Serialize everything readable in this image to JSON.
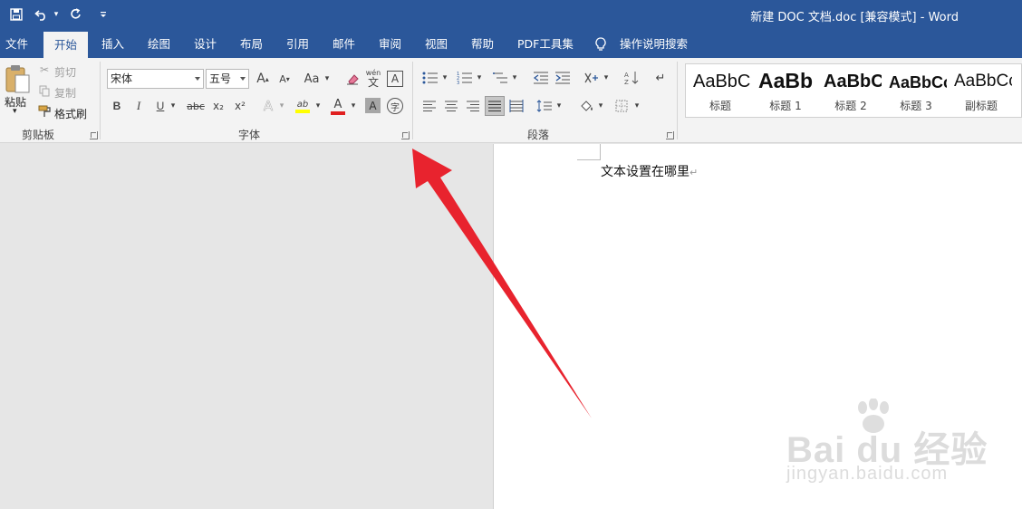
{
  "titlebar": {
    "title": "新建 DOC 文档.doc [兼容模式]  -  Word",
    "quick_access": [
      "save-icon",
      "undo-icon",
      "redo-icon",
      "customize-icon"
    ]
  },
  "tabs": [
    "文件",
    "开始",
    "插入",
    "绘图",
    "设计",
    "布局",
    "引用",
    "邮件",
    "审阅",
    "视图",
    "帮助",
    "PDF工具集",
    "操作说明搜索"
  ],
  "active_tab": "开始",
  "clipboard": {
    "paste_label": "粘贴",
    "cut_label": "剪切",
    "copy_label": "复制",
    "format_painter_label": "格式刷",
    "group_label": "剪贴板"
  },
  "font": {
    "font_name": "宋体",
    "font_size": "五号",
    "grow_label": "A",
    "shrink_label": "A",
    "case_label": "Aa",
    "phonetic_label": "wén",
    "phonetic_char": "文",
    "border_label": "A",
    "bold_label": "B",
    "italic_label": "I",
    "underline_label": "U",
    "strike_label": "abc",
    "subscript_label": "x₂",
    "superscript_label": "x²",
    "effects_label": "A",
    "highlight_label": "ab",
    "color_label": "A",
    "shading_label": "A",
    "enclose_label": "字",
    "group_label": "字体",
    "colors": {
      "highlight": "#ffff00",
      "font_color": "#e02020"
    }
  },
  "paragraph": {
    "group_label": "段落"
  },
  "styles": [
    {
      "sample": "AaBbCcDd",
      "name": "标题"
    },
    {
      "sample": "AaBb",
      "name": "标题 1"
    },
    {
      "sample": "AaBbC",
      "name": "标题 2"
    },
    {
      "sample": "AaBbCc",
      "name": "标题 3"
    },
    {
      "sample": "AaBbCcD",
      "name": "副标题"
    }
  ],
  "document": {
    "text": "文本设置在哪里"
  },
  "watermark": {
    "brand": "Bai du 经验",
    "url": "jingyan.baidu.com"
  },
  "colors": {
    "accent": "#2b579a",
    "arrow": "#e8232e"
  }
}
